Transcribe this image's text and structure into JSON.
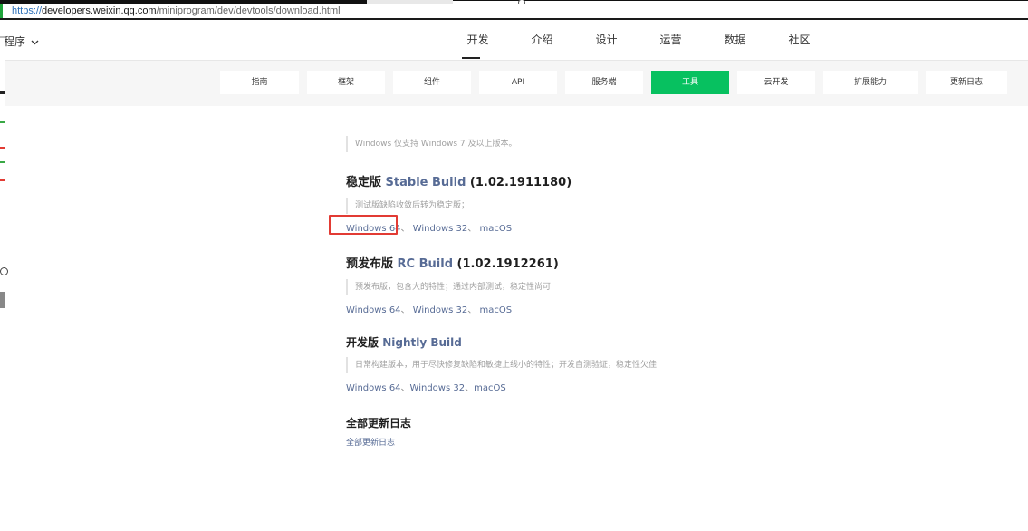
{
  "browser": {
    "url_scheme": "https://",
    "url_host": "developers.weixin.qq.com",
    "url_path": "/miniprogram/dev/devtools/download.html"
  },
  "header": {
    "program_switch": "程序",
    "nav": [
      "开发",
      "介绍",
      "设计",
      "运营",
      "数据",
      "社区"
    ],
    "active_nav": "开发"
  },
  "subnav": {
    "items": [
      "指南",
      "框架",
      "组件",
      "API",
      "服务端",
      "工具",
      "云开发",
      "扩展能力",
      "更新日志"
    ],
    "active": "工具"
  },
  "content": {
    "windows_note": "Windows 仅支持 Windows 7 及以上版本。",
    "stable": {
      "title_cn": "稳定版",
      "title_en": "Stable Build",
      "version": "(1.02.1911180)",
      "note": "测试版缺陷收敛后转为稳定版；",
      "links": [
        "Windows 64",
        "Windows 32",
        "macOS"
      ],
      "sep": "、"
    },
    "rc": {
      "title_cn": "预发布版",
      "title_en": "RC Build",
      "version": "(1.02.1912261)",
      "note": "预发布版，包含大的特性；通过内部测试，稳定性尚可",
      "links": [
        "Windows 64",
        "Windows 32",
        "macOS"
      ],
      "sep": "、"
    },
    "nightly": {
      "title_cn": "开发版",
      "title_en": "Nightly Build",
      "note": "日常构建版本，用于尽快修复缺陷和敏捷上线小的特性；开发自测验证，稳定性欠佳",
      "links": [
        "Windows 64",
        "Windows 32",
        "macOS"
      ],
      "sep": "、"
    },
    "changelog": {
      "title": "全部更新日志",
      "link": "全部更新日志"
    }
  },
  "colors": {
    "accent_green": "#07c160",
    "link_blue": "#576b95",
    "highlight_red": "#e23b34"
  }
}
